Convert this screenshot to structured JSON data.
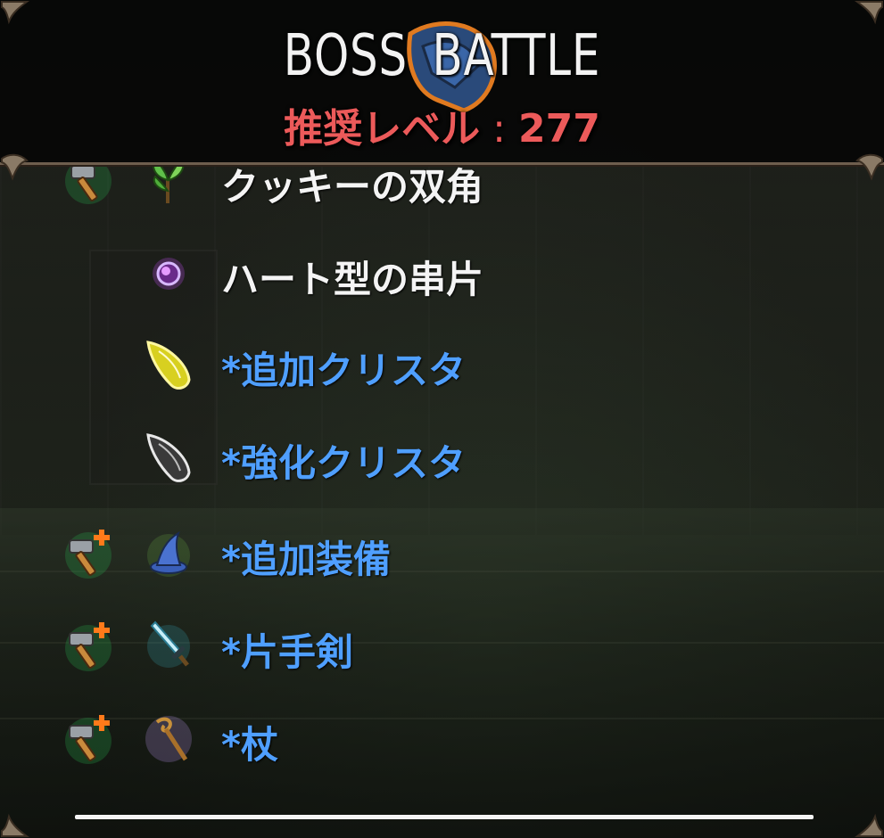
{
  "header": {
    "title": "BOSS BATTLE",
    "level_label": "推奨レベル",
    "level_separator": ":",
    "level_value": "277",
    "emblem_icon": "boss-helmet-icon"
  },
  "drops": [
    {
      "label": "クッキーの双角",
      "color": "white",
      "drop_icon": "hammer-drop-icon",
      "item_icon": "leaf-horn-icon"
    },
    {
      "label": "ハート型の串片",
      "color": "white",
      "drop_icon": "",
      "item_icon": "purple-orb-icon"
    },
    {
      "label": "*追加クリスタ",
      "color": "blue",
      "drop_icon": "",
      "item_icon": "yellow-crystal-icon"
    },
    {
      "label": "*強化クリスタ",
      "color": "blue",
      "drop_icon": "",
      "item_icon": "white-crystal-icon"
    },
    {
      "label": "*追加装備",
      "color": "blue",
      "drop_icon": "hammer-plus-icon",
      "item_icon": "wizard-hat-icon"
    },
    {
      "label": "*片手剣",
      "color": "blue",
      "drop_icon": "hammer-plus-icon",
      "item_icon": "sword-icon"
    },
    {
      "label": "*杖",
      "color": "blue",
      "drop_icon": "hammer-plus-icon",
      "item_icon": "staff-icon"
    }
  ],
  "colors": {
    "header_bg": "#050505",
    "title": "#f2f2f2",
    "level": "#ec5a5a",
    "item_white": "#f4f4f4",
    "item_blue": "#4f9fff",
    "border": "#6e5e4e"
  }
}
